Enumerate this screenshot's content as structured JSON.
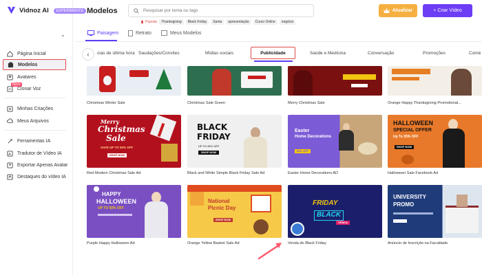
{
  "brand": {
    "name": "Vidnoz AI",
    "badge": "EXPERIMENTE"
  },
  "sidebar": {
    "items": [
      {
        "label": "Página Inicial",
        "icon": "home-icon"
      },
      {
        "label": "Modelos",
        "icon": "template-icon"
      },
      {
        "label": "Avatares",
        "icon": "avatar-icon"
      },
      {
        "label": "Clonar Voz",
        "icon": "voice-icon",
        "badge": "Novo"
      },
      {
        "label": "Minhas Criações",
        "icon": "play-icon"
      },
      {
        "label": "Meus Arquivos",
        "icon": "cloud-icon"
      },
      {
        "label": "Ferramentas IA",
        "icon": "ai-tools-icon"
      },
      {
        "label": "Tradutor de Vídeo IA",
        "icon": "translate-icon"
      },
      {
        "label": "Exportar Apenas Avatar",
        "icon": "export-icon"
      },
      {
        "label": "Destaques do vídeo IA",
        "icon": "highlight-icon"
      }
    ]
  },
  "header": {
    "title": "Modelos",
    "search_placeholder": "Pesquisar por tema ou tags",
    "popular_label": "Popular",
    "tags": [
      "Thanksgiving",
      "Black Friday",
      "Santa",
      "apresentação",
      "Curso Online",
      "negócio"
    ],
    "upgrade_label": "Atualizar",
    "create_label": "+ Criar Vídeo"
  },
  "subtabs": [
    "Paisagem",
    "Retrato",
    "Meus Modelos"
  ],
  "categories": [
    "cias de última hora",
    "Saudações/Convites",
    "Mídias sociais",
    "Publicidade",
    "Saúde e Medicina",
    "Conversação",
    "Promoções",
    "Comé"
  ],
  "templates": [
    {
      "title": "Christmas Winter Sale",
      "bg": "#e8eef3"
    },
    {
      "title": "Christmas Sale Green",
      "bg": "#2d6e4e"
    },
    {
      "title": "Merry Christmas Sale",
      "bg": "#7a1010"
    },
    {
      "title": "Orange Happy Thanksgiving Promotional...",
      "bg": "#f3eee6"
    },
    {
      "title": "Red Modern Christmas Sale Ad",
      "bg": "#b3101d",
      "t1": "Merry",
      "t2": "Christmas",
      "t3": "Sale",
      "t4": "SAVE UP TO 50% OFF",
      "t5": "SHOP NOW"
    },
    {
      "title": "Black and White Simple Black Friday Sale Ad",
      "bg": "#f0f0f0",
      "t1": "BLACK",
      "t2": "FRIDAY",
      "t3": "UP TO 50% OFF",
      "t4": "SHOP NOW"
    },
    {
      "title": "Easter Home Decorations AD",
      "bg": "#7c5bd6",
      "t1": "Easter",
      "t2": "Home Decorations",
      "t3": "30% OFF"
    },
    {
      "title": "Halloween Sale Facebook Ad",
      "bg": "#1a1a1a",
      "t1": "HALLOWEEN",
      "t2": "SPECIAL OFFER",
      "t3": "Up To 35% OFF",
      "t4": "SHOP NOW"
    },
    {
      "title": "Purple Happy Halloween Ad",
      "bg": "#7a4fc2",
      "t1": "HAPPY",
      "t2": "HALLOWEEN",
      "t3": "UP TO 50% OFF"
    },
    {
      "title": "Orange Yellow Basket Sale Ad",
      "bg": "#f7c948",
      "t1": "National",
      "t2": "Picnic Day",
      "t3": "SHOP NOW"
    },
    {
      "title": "Venda de Black Friday",
      "bg": "#1b1f6b",
      "t1": "FRIDAY",
      "t2": "BLACK",
      "t3": "VENDA"
    },
    {
      "title": "Anúncio de Inscrição na Faculdade",
      "bg": "#1f3b7a",
      "t1": "UNIVERSITY",
      "t2": "PROMO"
    }
  ],
  "colors": {
    "accent": "#5b3df5",
    "highlight": "#e04b4b",
    "upgrade": "#f5b041",
    "create": "#6d3df5"
  }
}
